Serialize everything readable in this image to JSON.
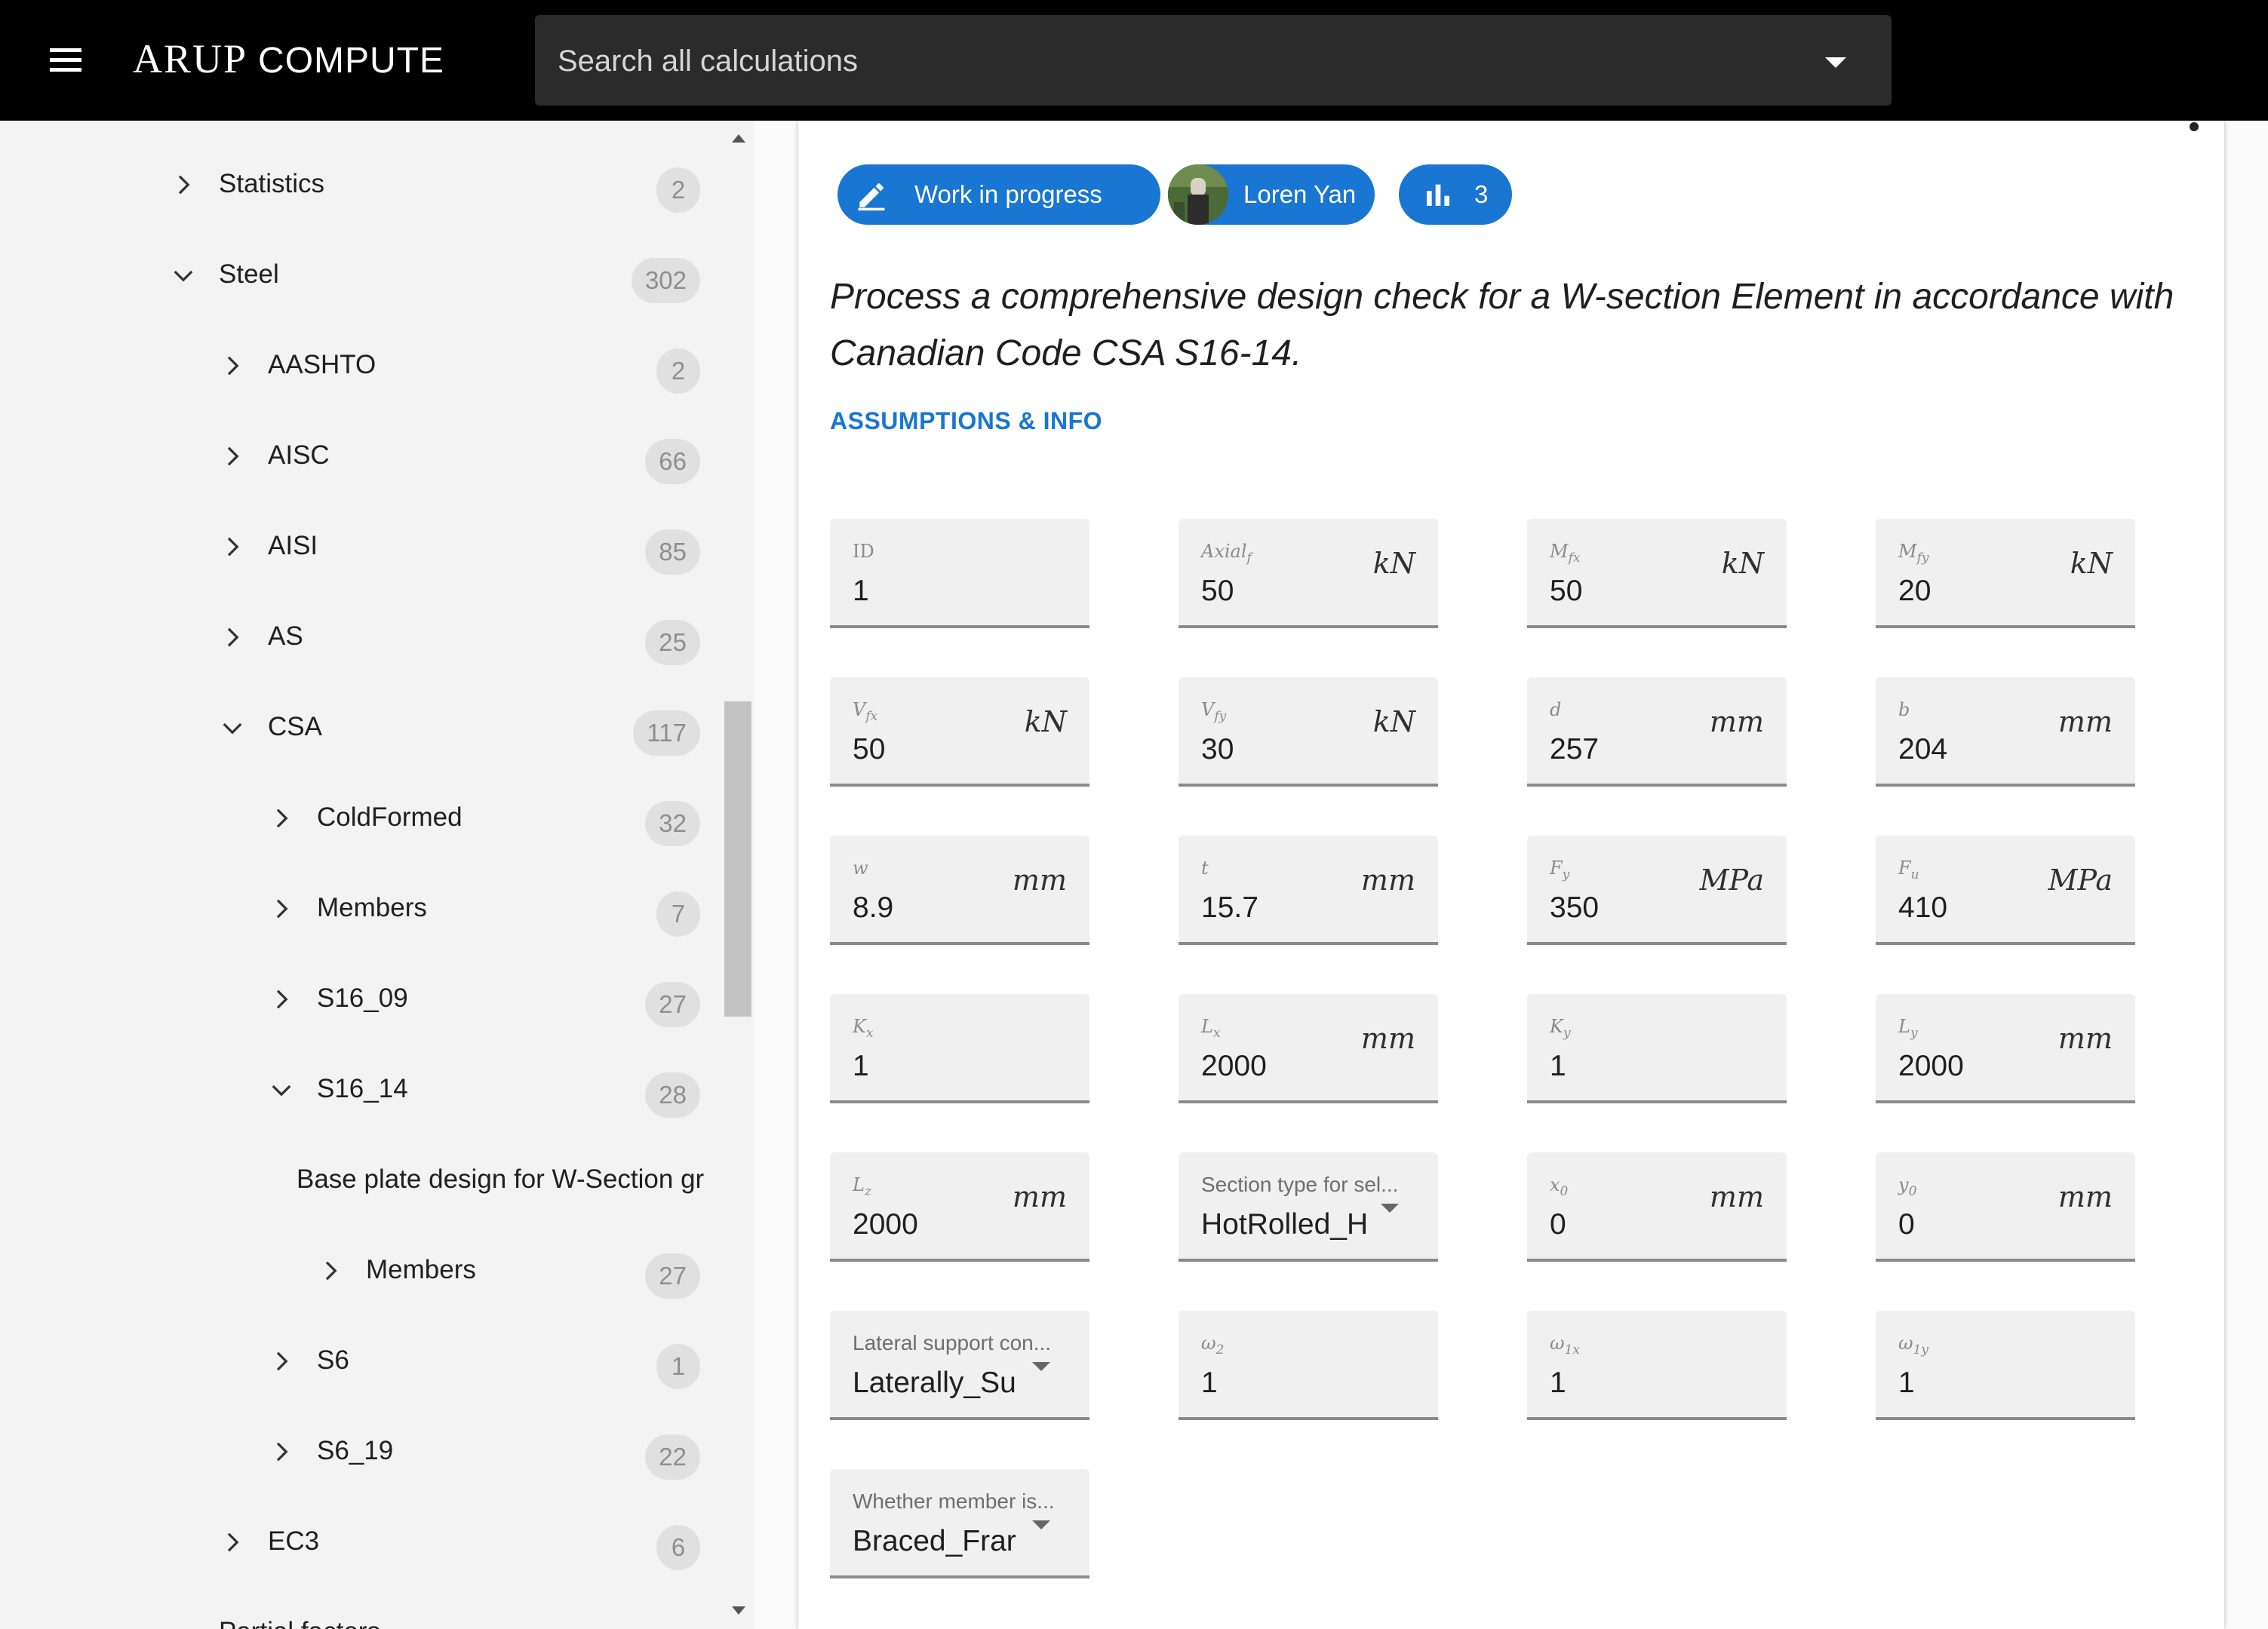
{
  "header": {
    "logo_bold": "ARUP",
    "logo_light": "COMPUTE",
    "search_placeholder": "Search all calculations"
  },
  "sidebar": {
    "items": [
      {
        "label": "Statistics",
        "count": "2",
        "expanded": false
      },
      {
        "label": "Steel",
        "count": "302",
        "expanded": true
      },
      {
        "label": "AASHTO",
        "count": "2",
        "expanded": false
      },
      {
        "label": "AISC",
        "count": "66",
        "expanded": false
      },
      {
        "label": "AISI",
        "count": "85",
        "expanded": false
      },
      {
        "label": "AS",
        "count": "25",
        "expanded": false
      },
      {
        "label": "CSA",
        "count": "117",
        "expanded": true
      },
      {
        "label": "ColdFormed",
        "count": "32",
        "expanded": false
      },
      {
        "label": "Members",
        "count": "7",
        "expanded": false
      },
      {
        "label": "S16_09",
        "count": "27",
        "expanded": false
      },
      {
        "label": "S16_14",
        "count": "28",
        "expanded": true
      },
      {
        "label": "Base plate design for W-Section gr"
      },
      {
        "label": "Members",
        "count": "27",
        "expanded": false
      },
      {
        "label": "S6",
        "count": "1",
        "expanded": false
      },
      {
        "label": "S6_19",
        "count": "22",
        "expanded": false
      },
      {
        "label": "EC3",
        "count": "6",
        "expanded": false
      },
      {
        "label": "Partial factors"
      }
    ]
  },
  "main": {
    "chips": {
      "status": "Work in progress",
      "author": "Loren Yan",
      "stats_count": "3"
    },
    "description": "Process a comprehensive design check for a W-section Element in accordance with Canadian Code CSA S16-14.",
    "assumptions_link": "ASSUMPTIONS & INFO",
    "fields": [
      {
        "label": "ID",
        "value": "1",
        "unit": ""
      },
      {
        "label": "Axial_f",
        "value": "50",
        "unit": "kN"
      },
      {
        "label": "M_fx",
        "value": "50",
        "unit": "kN"
      },
      {
        "label": "M_fy",
        "value": "20",
        "unit": "kN"
      },
      {
        "label": "V_fx",
        "value": "50",
        "unit": "kN"
      },
      {
        "label": "V_fy",
        "value": "30",
        "unit": "kN"
      },
      {
        "label": "d",
        "value": "257",
        "unit": "mm"
      },
      {
        "label": "b",
        "value": "204",
        "unit": "mm"
      },
      {
        "label": "w",
        "value": "8.9",
        "unit": "mm"
      },
      {
        "label": "t",
        "value": "15.7",
        "unit": "mm"
      },
      {
        "label": "F_y",
        "value": "350",
        "unit": "MPa"
      },
      {
        "label": "F_u",
        "value": "410",
        "unit": "MPa"
      },
      {
        "label": "K_x",
        "value": "1",
        "unit": ""
      },
      {
        "label": "L_x",
        "value": "2000",
        "unit": "mm"
      },
      {
        "label": "K_y",
        "value": "1",
        "unit": ""
      },
      {
        "label": "L_y",
        "value": "2000",
        "unit": "mm"
      },
      {
        "label": "L_z",
        "value": "2000",
        "unit": "mm"
      },
      {
        "label": "Section type for sel...",
        "value": "HotRolled_H",
        "unit": "",
        "select": true
      },
      {
        "label": "x_0",
        "value": "0",
        "unit": "mm"
      },
      {
        "label": "y_0",
        "value": "0",
        "unit": "mm"
      },
      {
        "label": "Lateral support con...",
        "value": "Laterally_Su",
        "unit": "",
        "select": true
      },
      {
        "label": "ω_2",
        "value": "1",
        "unit": ""
      },
      {
        "label": "ω_1x",
        "value": "1",
        "unit": ""
      },
      {
        "label": "ω_1y",
        "value": "1",
        "unit": ""
      },
      {
        "label": "Whether member is...",
        "value": "Braced_Frar",
        "unit": "",
        "select": true
      }
    ]
  },
  "colors": {
    "accent": "#1976d2",
    "topbar": "#000000",
    "sidebar": "#f3f3f3",
    "field_bg": "#f0f0f0"
  },
  "icons": {
    "menu": "hamburger-icon",
    "search_dropdown": "caret-down-icon",
    "status": "pencil-icon",
    "stats": "bar-chart-icon",
    "collapsed": "chevron-right-icon",
    "expanded": "chevron-down-icon"
  }
}
